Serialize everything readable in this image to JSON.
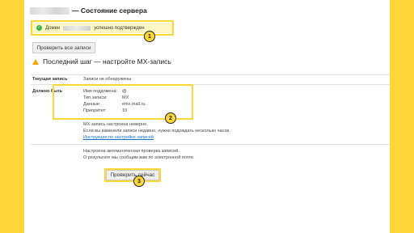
{
  "header": {
    "title": "— Состояние сервера"
  },
  "notice": {
    "prefix": "Домен",
    "suffix": "успешно подтвержден"
  },
  "buttons": {
    "check_all": "Проверить все записи",
    "check_now": "Проверить сейчас"
  },
  "step": {
    "title": "Последний шаг — настройте MX-запись"
  },
  "current": {
    "label": "Текущая запись",
    "value": "Записи не обнаружены"
  },
  "required": {
    "label": "Должно быть",
    "fields": [
      {
        "name": "Имя поддомена:",
        "value": "@"
      },
      {
        "name": "Тип записи:",
        "value": "MX"
      },
      {
        "name": "Данные:",
        "value": "emx.mail.ru."
      },
      {
        "name": "Приоритет:",
        "value": "10"
      }
    ]
  },
  "info": {
    "line1": "MX-запись настроена неверно.",
    "line2": "Если вы изменили записи недавно, нужно подождать несколько часов.",
    "link": "Инструкция по настройке записей"
  },
  "auto": {
    "line1": "Настроена автоматическая проверка записей.",
    "line2": "О результате мы сообщим вам по электронной почте."
  },
  "badges": [
    "1",
    "2",
    "3"
  ],
  "colors": {
    "highlight": "#ffd838",
    "success_bg": "#fff7c4",
    "check": "#39b54a",
    "warning": "#f2a200",
    "link": "#1a6fc9"
  }
}
